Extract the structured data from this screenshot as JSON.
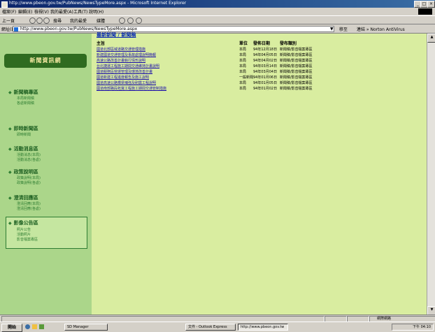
{
  "window": {
    "title": "http://www.pbeon.gov.tw/PubNews/NewsTypeMore.aspx - Microsoft Internet Explorer",
    "controls": [
      "_",
      "□",
      "×"
    ]
  },
  "menubar": {
    "items": [
      "檔案(F)",
      "編輯(E)",
      "檢視(V)",
      "我的最愛(A)",
      "工具(T)",
      "說明(H)"
    ]
  },
  "toolbar": {
    "back": "上一頁",
    "items": [
      "搜尋",
      "我的最愛",
      "媒體"
    ]
  },
  "addressbar": {
    "label": "網址(D)",
    "url": "http://www.pbeon.gov.tw/PubNews/NewsTypeMore.aspx",
    "go": "移至",
    "links": "連結 » Norton AntiVirus"
  },
  "sidebar": {
    "logo": "新聞資訊網",
    "groups": [
      {
        "head": "新聞稿專區",
        "subs": [
          "本局新聞稿",
          "各處新聞稿"
        ]
      },
      {
        "head": "即時新聞區",
        "subs": [
          "即時新聞"
        ]
      },
      {
        "head": "活動消息區",
        "subs": [
          "活動消息(本局)",
          "活動消息(各處)"
        ]
      },
      {
        "head": "政策說明區",
        "subs": [
          "政策說明(本局)",
          "政策說明(各處)"
        ]
      },
      {
        "head": "澄清回應區",
        "subs": [
          "澄清回應(本局)",
          "澄清回應(各處)"
        ]
      },
      {
        "head": "影像公告區",
        "subs": [
          "照片公告",
          "活動照片",
          "影音檔案專區"
        ]
      }
    ]
  },
  "content": {
    "breadcrumb": "最新新聞 / 新聞稿",
    "headers": {
      "title": "主旨",
      "unit": "單位",
      "date": "發佈日期",
      "category": "發布類別"
    },
    "rows": [
      {
        "title": "國道北部區域道路交通管理措施",
        "unit": "本局",
        "date": "94年12月18日",
        "category": "新聞稿/影音檔案專區"
      },
      {
        "title": "新建國道交通管理及事故處理說明簡報",
        "unit": "本局",
        "date": "94年04月05日",
        "category": "新聞稿/影音檔案專區"
      },
      {
        "title": "高速公路改善計畫執行情形說明",
        "unit": "本局",
        "date": "94年04月02日",
        "category": "新聞稿/影音檔案專區"
      },
      {
        "title": "台北捷運工程施工期間交通維持計畫說明",
        "unit": "本局",
        "date": "94年03月14日",
        "category": "新聞稿/影音檔案專區"
      },
      {
        "title": "國道服務區營運管理及環境改善計畫",
        "unit": "本局",
        "date": "94年03月04日",
        "category": "新聞稿/影音檔案專區"
      },
      {
        "title": "國道新建工程進度報告及施工說明",
        "unit": "一般新聞",
        "date": "94年01月06日",
        "category": "新聞稿/影音檔案專區"
      },
      {
        "title": "國道高速公路橋梁補強及耐震工程說明",
        "unit": "本局",
        "date": "94年01月05日",
        "category": "新聞稿/影音檔案專區"
      },
      {
        "title": "國道南部路段拓寬工程施工期間交通管制措施",
        "unit": "本局",
        "date": "94年01月02日",
        "category": "新聞稿/影音檔案專區"
      }
    ]
  },
  "statusbar": {
    "zone": "網際網路"
  },
  "taskbar": {
    "start": "開始",
    "tasks": [
      "SD Manager",
      "文件 - Outlook Express",
      "http://www.pbeon.gov.tw"
    ],
    "clock": "下午 04:10"
  }
}
